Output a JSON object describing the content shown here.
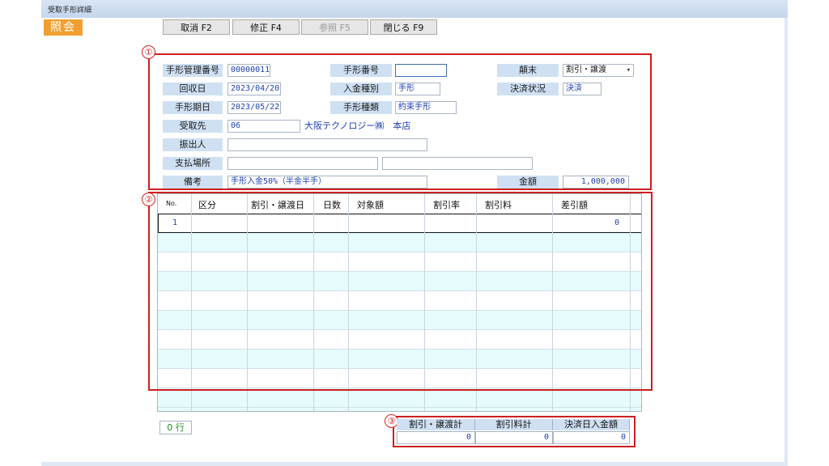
{
  "window": {
    "title": "受取手形詳細"
  },
  "mode_badge": "照会",
  "toolbar": [
    {
      "label": "取消 F2",
      "enabled": true
    },
    {
      "label": "修正 F4",
      "enabled": true
    },
    {
      "label": "参照 F5",
      "enabled": false
    },
    {
      "label": "閉じる F9",
      "enabled": true
    }
  ],
  "markers": [
    "①",
    "②",
    "③"
  ],
  "form": {
    "bill_mgmt_no": {
      "label": "手形管理番号",
      "value": "00000011"
    },
    "bill_no": {
      "label": "手形番号",
      "value": ""
    },
    "outcome": {
      "label": "顛末",
      "value": "割引・譲渡",
      "arrow": "▾"
    },
    "collection_date": {
      "label": "回収日",
      "value": "2023/04/20"
    },
    "deposit_type": {
      "label": "入金種別",
      "value": "手形"
    },
    "settlement_status": {
      "label": "決済状況",
      "value": "決済"
    },
    "due_date": {
      "label": "手形期日",
      "value": "2023/05/22"
    },
    "bill_type": {
      "label": "手形種類",
      "value": "約束手形"
    },
    "payee": {
      "label": "受取先",
      "code": "06",
      "name": "大阪テクノロジー㈱　本店"
    },
    "drawer": {
      "label": "振出人",
      "value": ""
    },
    "payment_place": {
      "label": "支払場所",
      "value1": "",
      "value2": ""
    },
    "remarks": {
      "label": "備考",
      "value": "手形入金50%（半金半手）"
    },
    "amount": {
      "label": "金額",
      "value": "1,000,000"
    }
  },
  "grid": {
    "columns": [
      "No.",
      "区分",
      "割引・譲渡日",
      "日数",
      "対象額",
      "割引率",
      "割引料",
      "差引額"
    ],
    "rows": [
      {
        "no": "1",
        "category": "",
        "date": "",
        "days": "",
        "target": "",
        "rate": "",
        "fee": "",
        "net": "0"
      }
    ]
  },
  "row_count": "0 行",
  "totals": {
    "headers": [
      "割引・譲渡計",
      "割引料計",
      "決済日入金額"
    ],
    "values": [
      "0",
      "0",
      "0"
    ]
  },
  "colors": {
    "accent_orange": "#f0a030",
    "marker_red": "#cc1f1f",
    "value_blue": "#1f3fb0",
    "label_bg": "#cfe0f3",
    "row_alt": "#e6fbfb"
  }
}
